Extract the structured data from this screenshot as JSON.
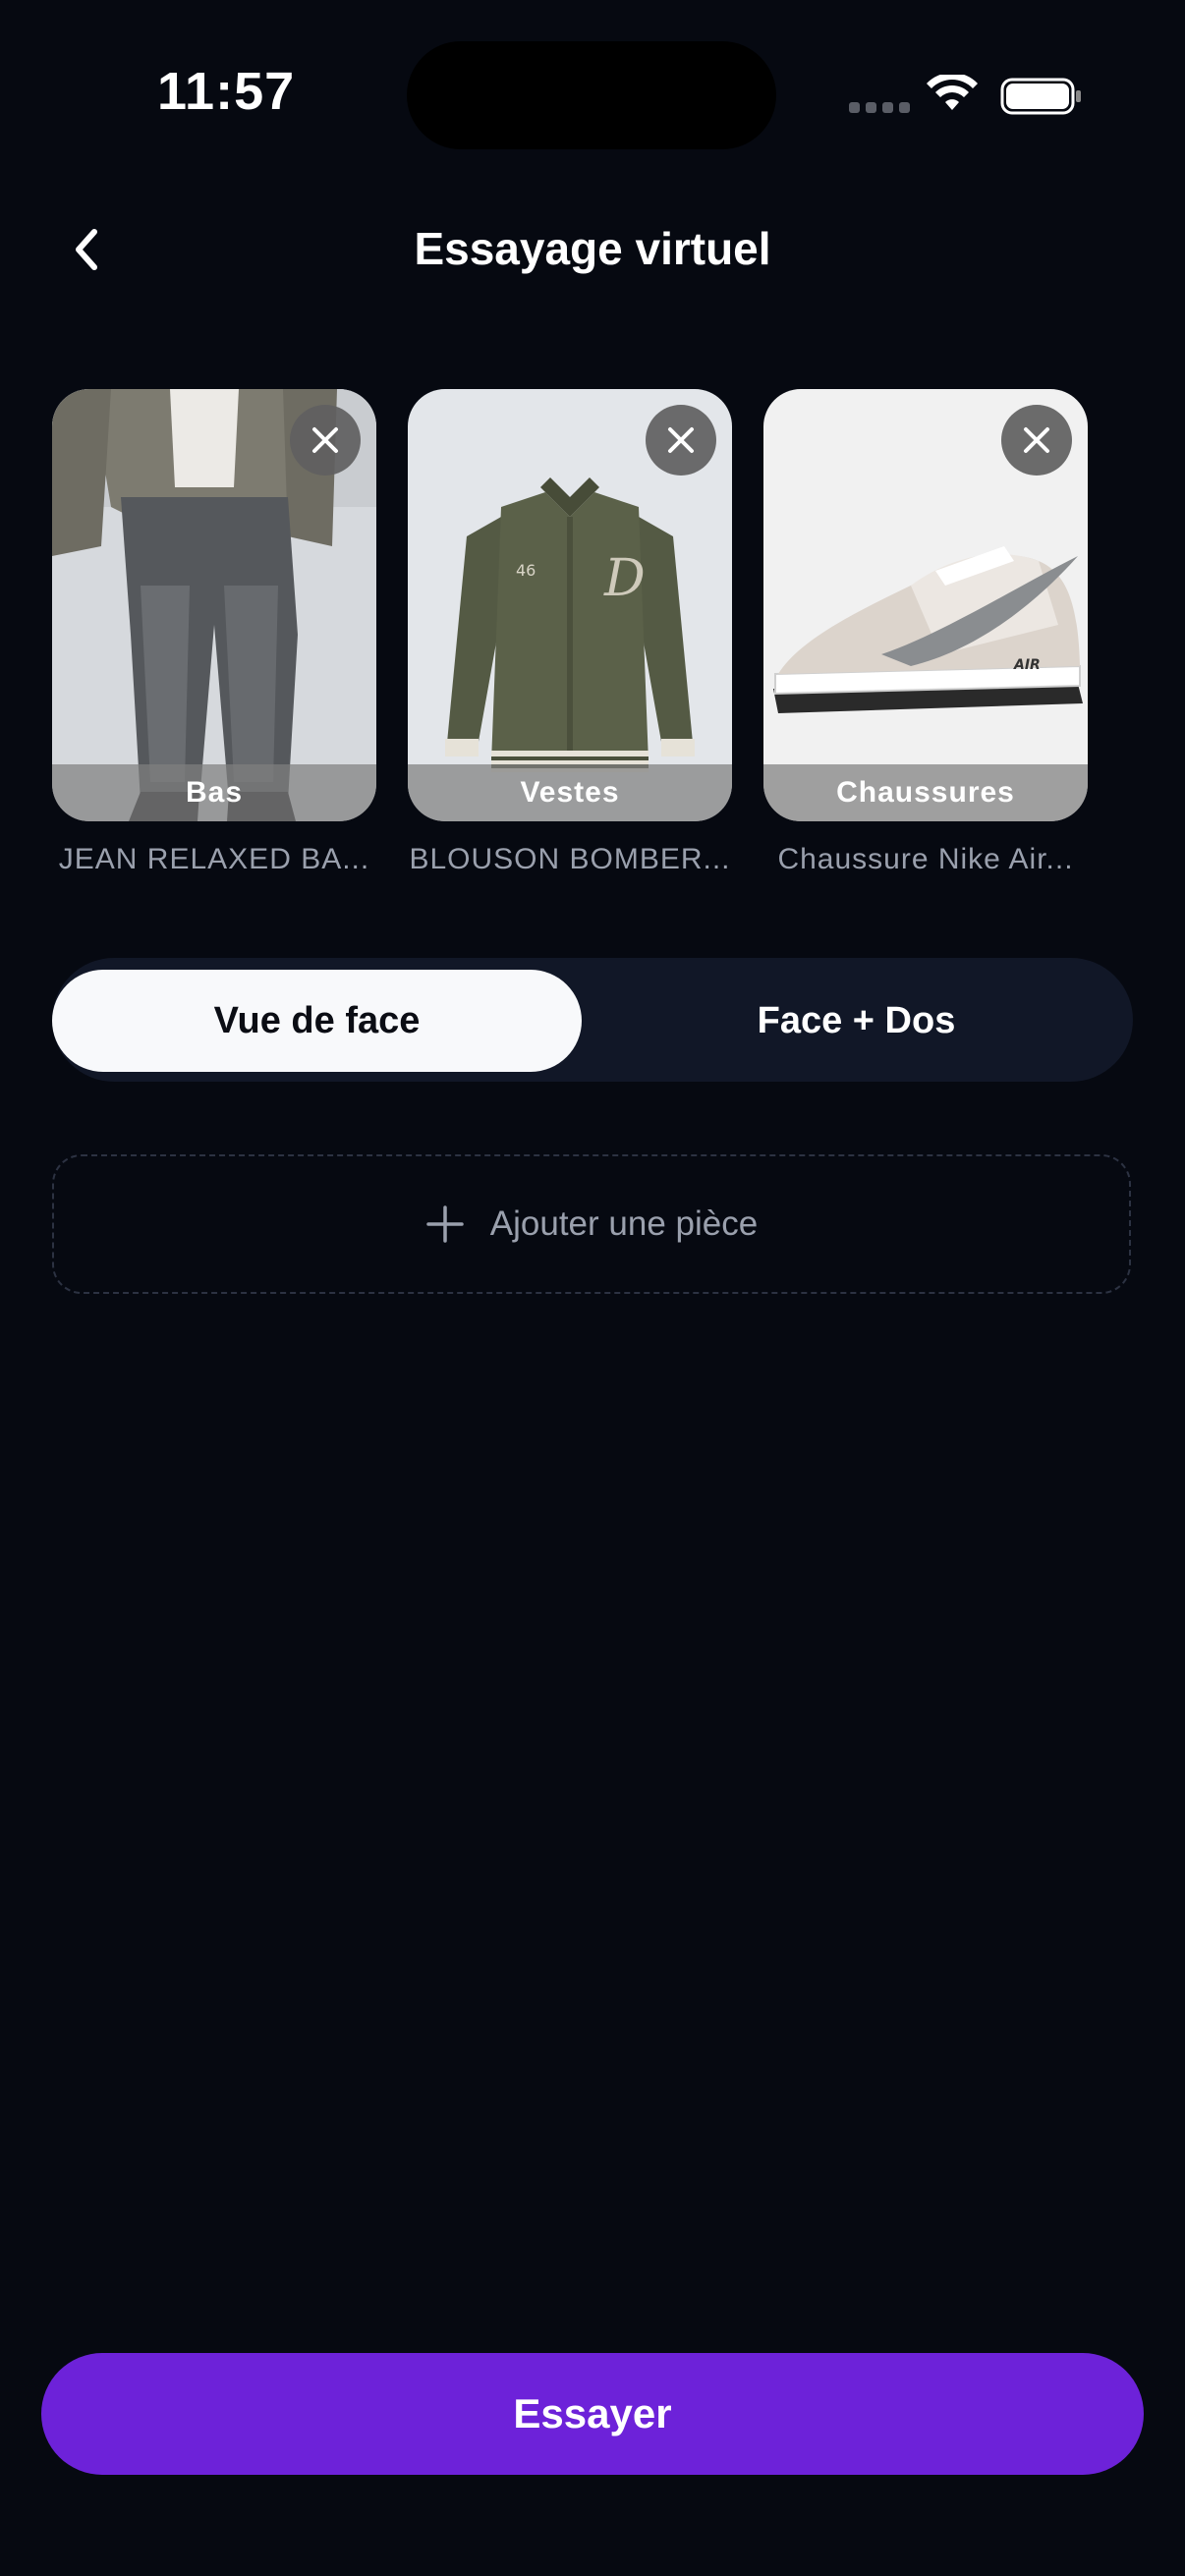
{
  "status_bar": {
    "time": "11:57"
  },
  "header": {
    "title": "Essayage virtuel",
    "back_icon": "chevron-left-icon"
  },
  "items": [
    {
      "category": "Bas",
      "name": "JEAN RELAXED BA..."
    },
    {
      "category": "Vestes",
      "name": "BLOUSON BOMBER..."
    },
    {
      "category": "Chaussures",
      "name": "Chaussure Nike Air..."
    }
  ],
  "view_toggle": {
    "options": [
      "Vue de face",
      "Face + Dos"
    ],
    "selected": "Vue de face"
  },
  "add_piece": {
    "label": "Ajouter une pièce",
    "icon": "plus-icon"
  },
  "cta": {
    "label": "Essayer"
  },
  "colors": {
    "background": "#060911",
    "accent": "#6d22d9",
    "segment_bg": "#111727",
    "muted_text": "#9aa0ad"
  }
}
